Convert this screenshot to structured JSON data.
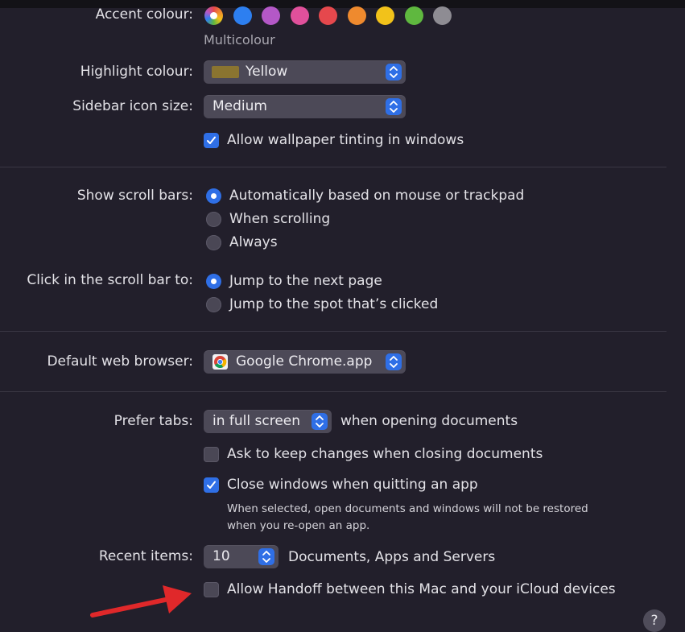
{
  "appearance": {
    "accent_label": "Accent colour:",
    "accent_selected": "Multicolour",
    "accent_swatches": [
      "multicolour-icon",
      "#2d7ff0",
      "#b458c7",
      "#e0509b",
      "#e5484d",
      "#ef8a2e",
      "#f2c21a",
      "#5fb83f",
      "#8e8c93"
    ],
    "highlight_label": "Highlight colour:",
    "highlight_value": "Yellow",
    "highlight_swatch_color": "#8a7430",
    "sidebar_icon_label": "Sidebar icon size:",
    "sidebar_icon_value": "Medium",
    "wallpaper_tinting_label": "Allow wallpaper tinting in windows",
    "wallpaper_tinting_checked": true
  },
  "scroll": {
    "show_label": "Show scroll bars:",
    "show_options": [
      "Automatically based on mouse or trackpad",
      "When scrolling",
      "Always"
    ],
    "show_selected": 0,
    "click_label": "Click in the scroll bar to:",
    "click_options": [
      "Jump to the next page",
      "Jump to the spot that’s clicked"
    ],
    "click_selected": 0
  },
  "browser": {
    "label": "Default web browser:",
    "value": "Google Chrome.app",
    "icon": "chrome-icon"
  },
  "documents": {
    "prefer_tabs_label": "Prefer tabs:",
    "prefer_tabs_value": "in full screen",
    "prefer_tabs_suffix": "when opening documents",
    "ask_keep_changes_label": "Ask to keep changes when closing documents",
    "ask_keep_changes_checked": false,
    "close_windows_label": "Close windows when quitting an app",
    "close_windows_checked": true,
    "close_windows_note_line1": "When selected, open documents and windows will not be restored",
    "close_windows_note_line2": "when you re-open an app.",
    "recent_items_label": "Recent items:",
    "recent_items_value": "10",
    "recent_items_suffix": "Documents, Apps and Servers",
    "handoff_label": "Allow Handoff between this Mac and your iCloud devices",
    "handoff_checked": false
  },
  "help_label": "?",
  "annotation": {
    "arrow_color": "#e0282a"
  }
}
